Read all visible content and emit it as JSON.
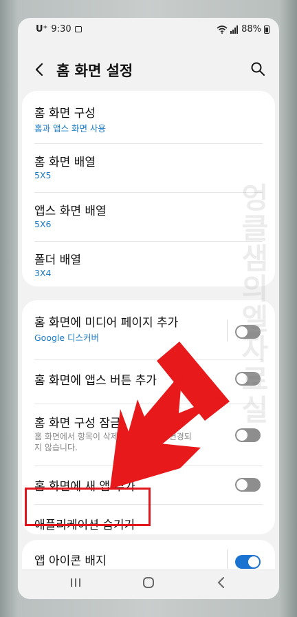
{
  "status": {
    "carrier": "U⁺",
    "time": "9:30",
    "battery": "88%"
  },
  "header": {
    "title": "홈 화면 설정",
    "back_icon": "chevron-left-icon",
    "search_icon": "search-icon"
  },
  "layout_section": [
    {
      "label": "홈 화면 구성",
      "value": "홈과 앱스 화면 사용"
    },
    {
      "label": "홈 화면 배열",
      "value": "5X5"
    },
    {
      "label": "앱스 화면 배열",
      "value": "5X6"
    },
    {
      "label": "폴더 배열",
      "value": "3X4"
    }
  ],
  "toggle_section": {
    "media_page": {
      "label": "홈 화면에 미디어 페이지 추가",
      "value": "Google 디스커버",
      "enabled": false
    },
    "apps_button": {
      "label": "홈 화면에 앱스 버튼 추가",
      "enabled": false
    },
    "lock_layout": {
      "label": "홈 화면 구성 잠금",
      "description": "홈 화면에서 항목이 삭제되거나 위치가 변경되지 않습니다.",
      "enabled": false
    },
    "add_new_apps": {
      "label": "홈 화면에 새 앱 추가",
      "enabled": false
    },
    "hide_apps": {
      "label": "애플리케이션 숨기기"
    }
  },
  "badge_section": {
    "app_icon_badge": {
      "label": "앱 아이콘 배지",
      "enabled": true
    }
  },
  "watermark": "엉클샘의엘자료실",
  "colors": {
    "accent": "#1a7bc4",
    "toggle_on": "#1a73d0",
    "toggle_off": "#8e8e8e",
    "highlight": "#e0161c"
  }
}
